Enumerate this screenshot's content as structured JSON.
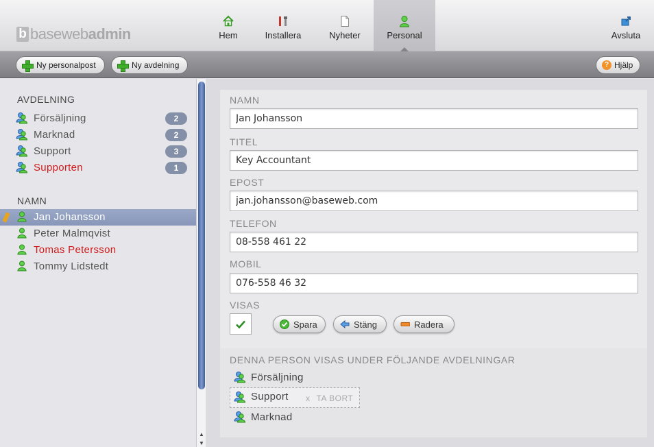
{
  "logo": {
    "mark": "b",
    "light": "baseweb",
    "bold": "admin"
  },
  "nav": [
    {
      "label": "Hem",
      "icon": "home-icon"
    },
    {
      "label": "Installera",
      "icon": "tools-icon"
    },
    {
      "label": "Nyheter",
      "icon": "document-icon"
    },
    {
      "label": "Personal",
      "icon": "person-icon",
      "active": true
    }
  ],
  "logout": {
    "label": "Avsluta",
    "icon": "logout-icon"
  },
  "toolbar": {
    "new_person": "Ny personalpost",
    "new_department": "Ny avdelning",
    "help": "Hjälp",
    "help_glyph": "?"
  },
  "sidebar": {
    "departments_heading": "AVDELNING",
    "departments": [
      {
        "label": "Försäljning",
        "count": "2"
      },
      {
        "label": "Marknad",
        "count": "2"
      },
      {
        "label": "Support",
        "count": "3"
      },
      {
        "label": "Supporten",
        "count": "1",
        "highlight": "#d01b1b"
      }
    ],
    "names_heading": "NAMN",
    "names": [
      {
        "label": "Jan Johansson",
        "selected": true
      },
      {
        "label": "Peter Malmqvist"
      },
      {
        "label": "Tomas Petersson",
        "highlight": "#d01b1b"
      },
      {
        "label": "Tommy Lidstedt"
      }
    ]
  },
  "form": {
    "name_label": "NAMN",
    "name_value": "Jan Johansson",
    "title_label": "TITEL",
    "title_value": "Key Accountant",
    "email_label": "EPOST",
    "email_value": "jan.johansson@baseweb.com",
    "phone_label": "TELEFON",
    "phone_value": "08-558 461 22",
    "mobile_label": "MOBIL",
    "mobile_value": "076-558 46 32",
    "visible_label": "VISAS",
    "visible_checked": true,
    "save": "Spara",
    "close": "Stäng",
    "delete": "Radera"
  },
  "assignments": {
    "heading": "DENNA PERSON VISAS UNDER FÖLJANDE AVDELNINGAR",
    "items": [
      {
        "label": "Försäljning"
      },
      {
        "label": "Support",
        "hover": true
      },
      {
        "label": "Marknad"
      }
    ],
    "remove_x": "x",
    "remove_label": "TA BORT"
  },
  "colors": {
    "selected_row": "#8f9dbf",
    "badge": "#8390a8",
    "warning_text": "#d01b1b",
    "scroll_thumb": "#4f6ea8",
    "add_green": "#3fae2a"
  }
}
